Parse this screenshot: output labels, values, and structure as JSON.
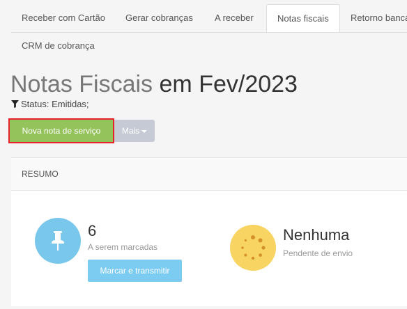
{
  "tabs": [
    {
      "label": "Receber com Cartão",
      "active": false
    },
    {
      "label": "Gerar cobranças",
      "active": false
    },
    {
      "label": "A receber",
      "active": false
    },
    {
      "label": "Notas fiscais",
      "active": true
    },
    {
      "label": "Retorno bancá",
      "active": false
    },
    {
      "label": "CRM de cobrança",
      "active": false
    }
  ],
  "page": {
    "title_part1": "Notas Fiscais",
    "title_part2": "em Fev/2023",
    "filter_text": "Status: Emitidas;"
  },
  "actions": {
    "new_label": "Nova nota de serviço",
    "more_label": "Mais"
  },
  "summary": {
    "header": "RESUMO",
    "cards": [
      {
        "icon": "pushpin-icon",
        "value": "6",
        "label": "A serem marcadas",
        "button": "Marcar e transmitir",
        "color": "#79c8ec"
      },
      {
        "icon": "spinner-icon",
        "value": "Nenhuma",
        "label": "Pendente de envio",
        "color": "#f8d463"
      }
    ]
  }
}
